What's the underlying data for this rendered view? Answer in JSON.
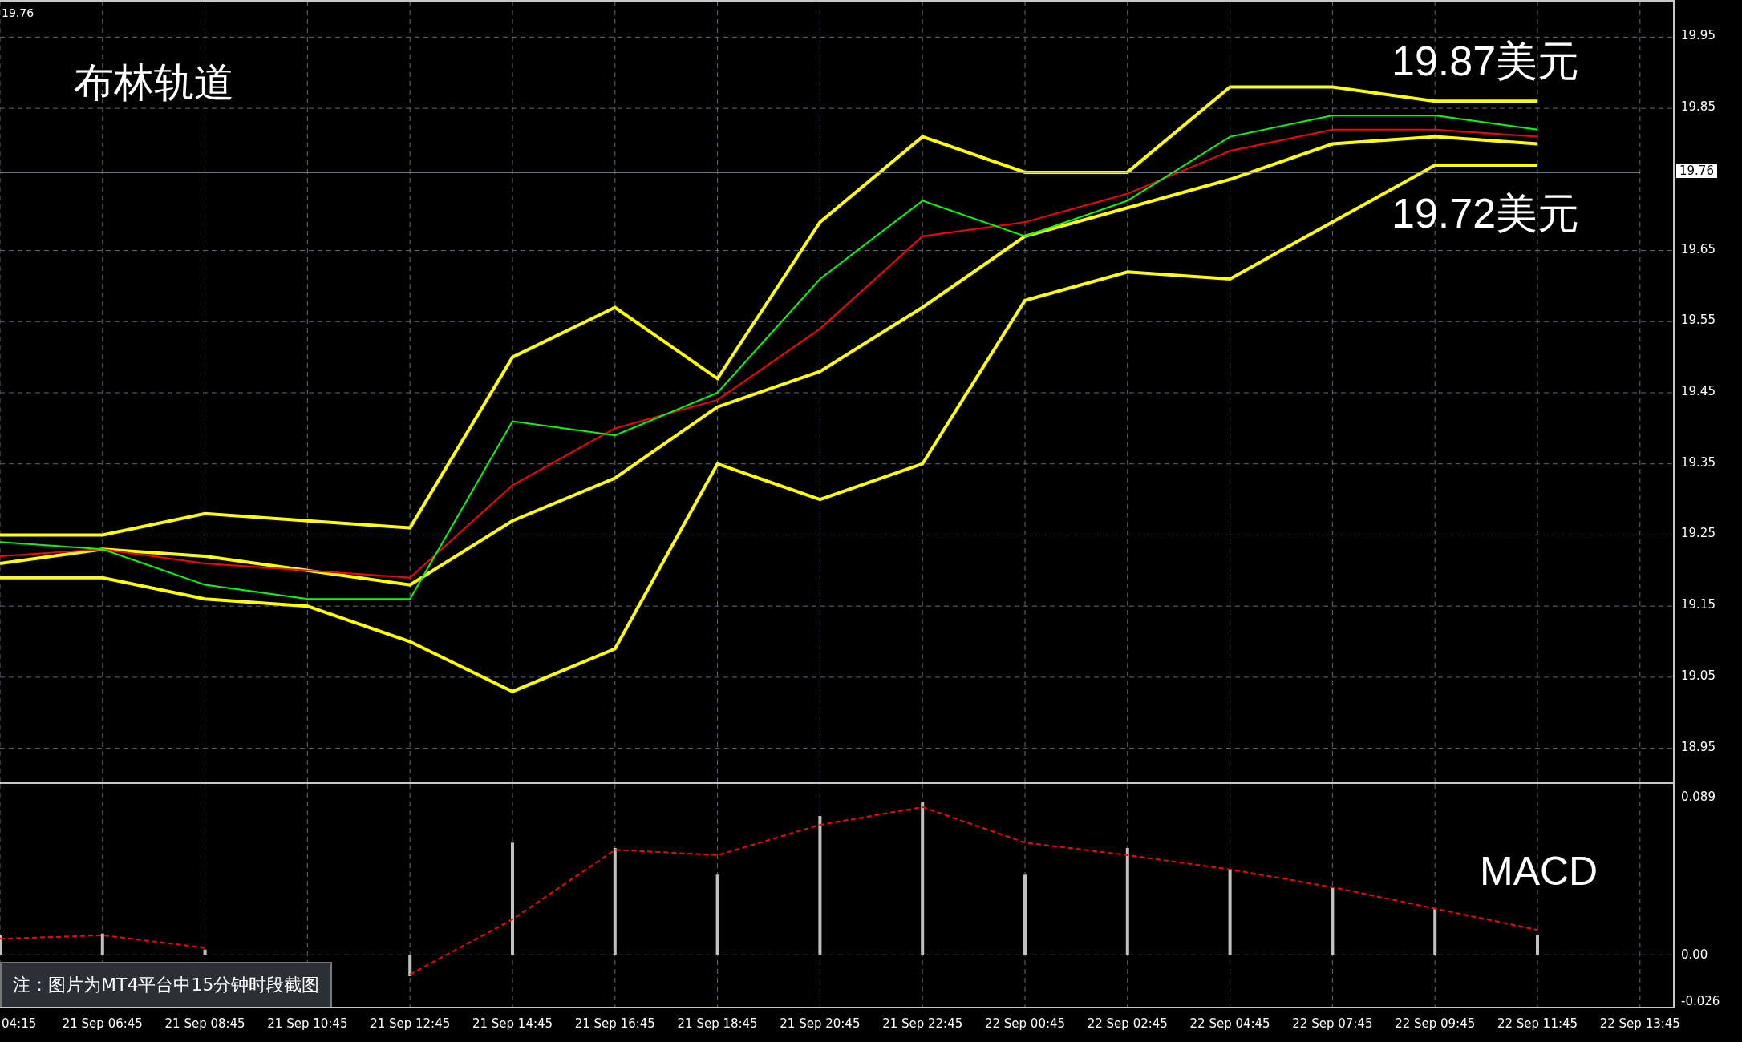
{
  "main_chart": {
    "top_left_label": "19.76",
    "title": "布林轨道",
    "upper_note": "19.87美元",
    "lower_note": "19.72美元",
    "current_price": "19.76",
    "chart_data": {
      "type": "line",
      "grid": true,
      "ylim": [
        18.9,
        20.0
      ],
      "yticks": [
        19.95,
        19.85,
        19.65,
        19.55,
        19.45,
        19.35,
        19.25,
        19.15,
        19.05,
        18.95
      ],
      "series": [
        {
          "color": "#ffff00",
          "values": [
            19.25,
            19.25,
            19.28,
            19.27,
            19.26,
            19.5,
            19.57,
            19.47,
            19.69,
            19.81,
            19.76,
            19.76,
            19.88,
            19.88,
            19.86,
            19.86,
            null
          ]
        },
        {
          "color": "#ffff00",
          "values": [
            19.21,
            19.23,
            19.22,
            19.2,
            19.18,
            19.27,
            19.33,
            19.43,
            19.48,
            19.57,
            19.67,
            19.71,
            19.75,
            19.8,
            19.81,
            19.8,
            null
          ]
        },
        {
          "color": "#ffff00",
          "values": [
            19.19,
            19.19,
            19.16,
            19.15,
            19.1,
            19.03,
            19.09,
            19.35,
            19.3,
            19.35,
            19.58,
            19.62,
            19.61,
            19.69,
            19.77,
            19.77,
            null
          ]
        },
        {
          "color": "#ff0000",
          "values": [
            19.22,
            19.23,
            19.21,
            19.2,
            19.19,
            19.32,
            19.4,
            19.44,
            19.54,
            19.67,
            19.69,
            19.73,
            19.79,
            19.82,
            19.82,
            19.81,
            null
          ]
        },
        {
          "color": "#00ff00",
          "values": [
            19.24,
            19.23,
            19.18,
            19.16,
            19.16,
            19.41,
            19.39,
            19.45,
            19.61,
            19.72,
            19.67,
            19.72,
            19.81,
            19.84,
            19.84,
            19.82,
            null
          ]
        },
        {
          "color": "#8f9aa6",
          "values": [
            19.76,
            19.76,
            19.76,
            19.76,
            19.76,
            19.76,
            19.76,
            19.76,
            19.76,
            19.76,
            19.76,
            19.76,
            19.76,
            19.76,
            19.76,
            19.76,
            19.76
          ]
        }
      ]
    }
  },
  "macd_panel": {
    "title": "MACD",
    "note": "注：图片为MT4平台中15分钟时段截图",
    "chart_data": {
      "type": "bar",
      "grid": true,
      "categories": [
        "04:15",
        "21 Sep 06:45",
        "21 Sep 08:45",
        "21 Sep 10:45",
        "21 Sep 12:45",
        "21 Sep 14:45",
        "21 Sep 16:45",
        "21 Sep 18:45",
        "21 Sep 20:45",
        "21 Sep 22:45",
        "22 Sep 00:45",
        "22 Sep 02:45",
        "22 Sep 04:45",
        "22 Sep 07:45",
        "22 Sep 09:45",
        "22 Sep 11:45",
        "22 Sep 13:45"
      ],
      "ylim": [
        -0.03,
        0.096
      ],
      "yticks": [
        {
          "value": 0.089,
          "label": "0.089"
        },
        {
          "value": 0,
          "label": "0.00"
        },
        {
          "value": -0.026,
          "label": "-0.026"
        }
      ],
      "series": [
        {
          "color": "#c0c0c0",
          "values": [
            0.011,
            0.012,
            0.003,
            null,
            -0.012,
            0.063,
            0.06,
            0.045,
            0.078,
            0.086,
            0.045,
            0.06,
            0.048,
            0.038,
            0.026,
            0.011,
            null
          ]
        },
        {
          "type": "line",
          "line_style": "dashed",
          "color": "#ff0000",
          "values": [
            0.009,
            0.011,
            0.004,
            null,
            -0.011,
            0.02,
            0.059,
            0.056,
            0.073,
            0.083,
            0.063,
            0.056,
            0.048,
            0.038,
            0.026,
            0.014,
            null
          ]
        }
      ]
    }
  }
}
